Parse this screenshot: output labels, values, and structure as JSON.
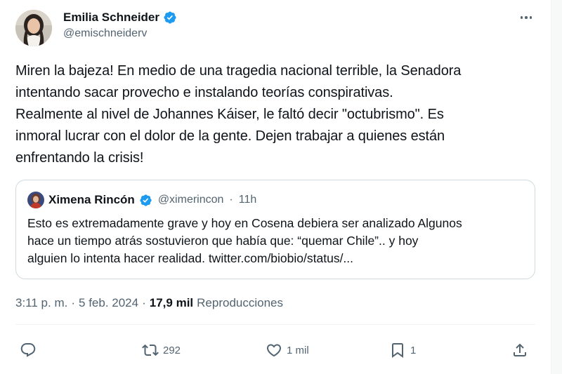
{
  "author": {
    "name": "Emilia Schneider",
    "handle": "@emischneiderv",
    "avatar_icon": "profile-photo"
  },
  "tweet_text_lines": [
    "Miren la bajeza! En medio de una tragedia nacional terrible, la Senadora",
    "intentando sacar provecho e instalando teorías conspirativas.",
    "Realmente al nivel de Johannes Káiser, le faltó decir \"octubrismo\". Es",
    "inmoral lucrar con el dolor de la gente. Dejen trabajar a quienes están",
    "enfrentando la crisis!"
  ],
  "quoted": {
    "name": "Ximena Rincón",
    "handle": "@ximerincon",
    "separator": "·",
    "time": "11h",
    "text_lines": [
      "Esto es extremadamente grave y hoy en Cosena debiera ser analizado Algunos",
      "hace un tiempo atrás sostuvieron que había que: “quemar Chile”.. y hoy",
      "alguien lo intenta hacer realidad. twitter.com/biobio/status/..."
    ]
  },
  "meta": {
    "time": "3:11 p. m.",
    "sep1": "·",
    "date": "5 feb. 2024",
    "sep2": "·",
    "views": "17,9 mil",
    "views_label": "Reproducciones"
  },
  "actions": {
    "reply_count": "",
    "retweet_count": "292",
    "like_count": "1 mil",
    "bookmark_count": "1"
  },
  "colors": {
    "verified": "#1d9bf0",
    "text": "#0f1419",
    "secondary": "#536471",
    "border": "#cfd9de"
  }
}
